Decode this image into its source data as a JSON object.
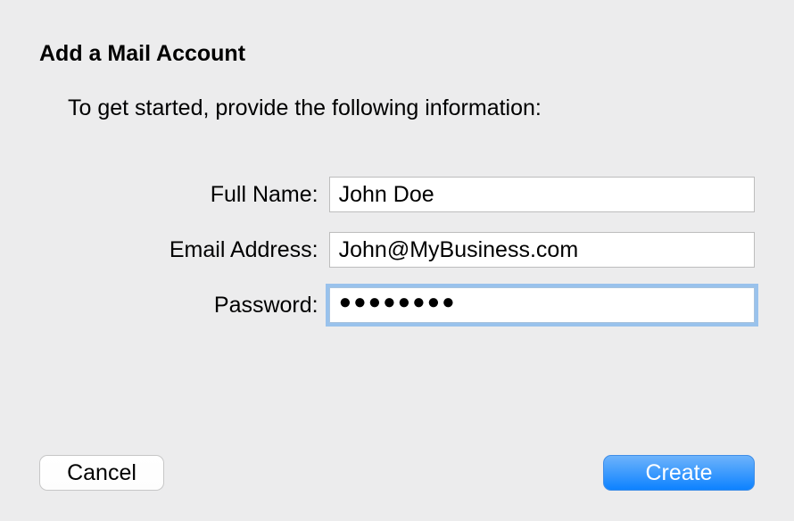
{
  "title": "Add a Mail Account",
  "instruction": "To get started, provide the following information:",
  "fields": {
    "fullName": {
      "label": "Full Name:",
      "value": "John Doe"
    },
    "email": {
      "label": "Email Address:",
      "value": "John@MyBusiness.com"
    },
    "password": {
      "label": "Password:",
      "masked": "●●●●●●●●"
    }
  },
  "buttons": {
    "cancel": "Cancel",
    "create": "Create"
  }
}
